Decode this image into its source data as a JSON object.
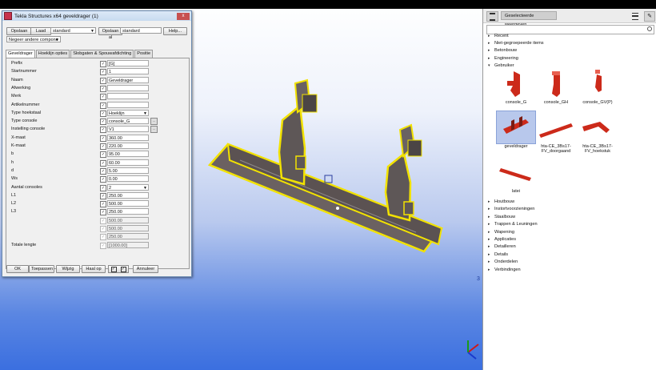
{
  "dialog": {
    "title": "Tekla Structures x64  geveldrager (1)",
    "close": "x",
    "buttons": {
      "save": "Opslaan",
      "load": "Laad",
      "save_as": "Opslaan al",
      "help": "Help..."
    },
    "preset_value": "standard",
    "save_as_value": "standard",
    "dim_combo": "Negeer andere compone",
    "tabs": [
      "Geveldrager",
      "Hoeklijn opties",
      "Slobgaten & Spouwafdichting",
      "Positie"
    ],
    "rows": [
      {
        "label": "Prefix",
        "value": "[G]",
        "checked": true
      },
      {
        "label": "Startnummer",
        "value": "1",
        "checked": true
      },
      {
        "label": "Naam",
        "value": "Geveldrager",
        "checked": true
      },
      {
        "label": "Afwerking",
        "value": "",
        "checked": true
      },
      {
        "label": "Merk",
        "value": "",
        "checked": true
      },
      {
        "label": "Artikelnummer",
        "value": "",
        "checked": true
      },
      {
        "label": "Type hoekstaal",
        "value": "Hoeklijn",
        "checked": true,
        "dropdown": true
      },
      {
        "label": "Type console",
        "value": "console_G",
        "checked": true,
        "browse": true
      },
      {
        "label": "Instelling console",
        "value": "V1",
        "checked": true,
        "browse": true
      },
      {
        "label": "X-maat",
        "value": "360.00",
        "checked": true
      },
      {
        "label": "K-maat",
        "value": "220.00",
        "checked": true
      },
      {
        "label": "b",
        "value": "95.00",
        "checked": true
      },
      {
        "label": "h",
        "value": "60.00",
        "checked": true
      },
      {
        "label": "d",
        "value": "5.00",
        "checked": true
      },
      {
        "label": "Ws",
        "value": "0.00",
        "checked": true
      },
      {
        "label": "Aantal consoles",
        "value": "2",
        "checked": true,
        "dropdown": true
      },
      {
        "label": "L1",
        "value": "250.00",
        "checked": true
      },
      {
        "label": "L2",
        "value": "500.00",
        "checked": true
      },
      {
        "label": "L3",
        "value": "250.00",
        "checked": true
      },
      {
        "label": "",
        "value": "500.00",
        "checked": true,
        "disabled": true
      },
      {
        "label": "",
        "value": "500.00",
        "checked": true,
        "disabled": true
      },
      {
        "label": "",
        "value": "250.00",
        "checked": true,
        "disabled": true
      },
      {
        "label": "Totale lengte",
        "value": "[1000.00]",
        "checked": true,
        "disabled": true
      }
    ],
    "bottom_buttons": {
      "ok": "OK",
      "apply": "Toepassen",
      "modify": "Wijzig",
      "get": "Haal op",
      "cancel": "Annuleer"
    },
    "check_symbol": "✓"
  },
  "viewport": {
    "corner_label": "3"
  },
  "catalog": {
    "title": "Geselecteerde weergeven",
    "tree_top": [
      {
        "label": "Recent",
        "arrow": "▸"
      },
      {
        "label": "Niet-gegroepeerde items",
        "arrow": "▸"
      },
      {
        "label": "Betonbouw",
        "arrow": "▸"
      },
      {
        "label": "Engineering",
        "arrow": "▸"
      },
      {
        "label": "Gebruiker",
        "arrow": "▾"
      }
    ],
    "items": [
      {
        "label": "console_G"
      },
      {
        "label": "console_GH"
      },
      {
        "label": "console_GV(P)"
      },
      {
        "label": "geveldrager",
        "selected": true
      },
      {
        "label": "hta-CE_3Bs17-FV_doorgaand"
      },
      {
        "label": "hta-CE_3Bs17-FV_hoekstuk"
      },
      {
        "label": "latei"
      }
    ],
    "tree_bottom": [
      {
        "label": "Houtbouw",
        "arrow": "▸"
      },
      {
        "label": "Instortvoorzieningen",
        "arrow": "▸"
      },
      {
        "label": "Staalbouw",
        "arrow": "▸"
      },
      {
        "label": "Trappen & Leuningen",
        "arrow": "▸"
      },
      {
        "label": "Wapening",
        "arrow": "▸"
      },
      {
        "label": "Applicaties",
        "arrow": "▸"
      },
      {
        "label": "Detailleren",
        "arrow": "▸"
      },
      {
        "label": "Details",
        "arrow": "▸"
      },
      {
        "label": "Onderdelen",
        "arrow": "▸"
      },
      {
        "label": "Verbindingen",
        "arrow": "▸"
      }
    ],
    "accent": "#cc2a1a",
    "selection_color": "#b8c8ec"
  }
}
